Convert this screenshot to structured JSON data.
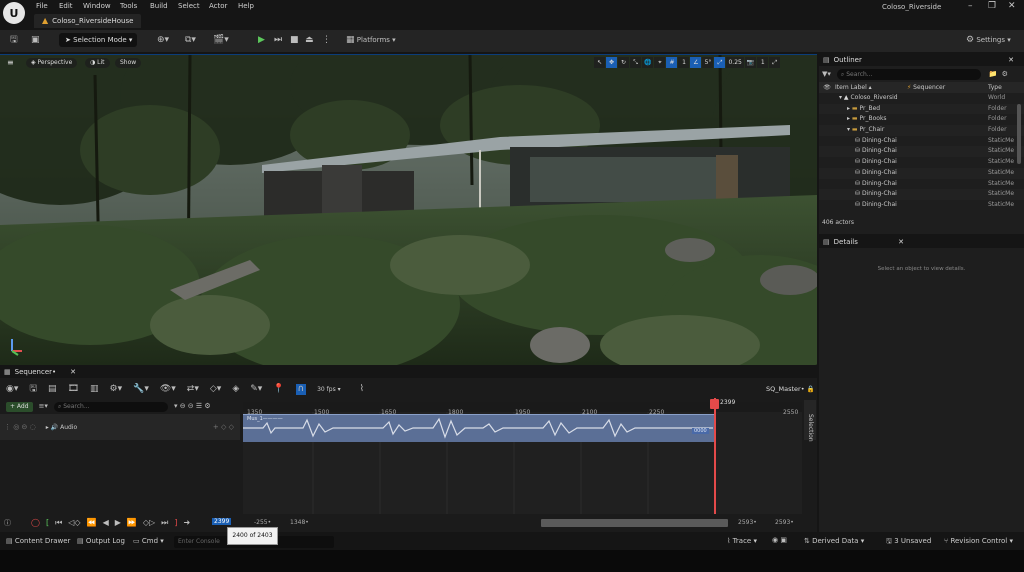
{
  "menu": {
    "items": [
      "File",
      "Edit",
      "Window",
      "Tools",
      "Build",
      "Select",
      "Actor",
      "Help"
    ],
    "project_tab": "Coloso_RiversideHouse",
    "window_title": "Coloso_Riverside"
  },
  "toolbar": {
    "selection_mode": "Selection Mode",
    "platforms": "Platforms",
    "settings": "Settings"
  },
  "viewport": {
    "perspective": "Perspective",
    "lit": "Lit",
    "show": "Show",
    "fov_value": "5°",
    "speed_value": "0.25",
    "cam_value": "1",
    "grid_value": "1"
  },
  "outliner": {
    "title": "Outliner",
    "search_placeholder": "Search...",
    "col_label": "Item Label ▴",
    "col_sequencer": "Sequencer",
    "col_type": "Type",
    "rows": [
      {
        "label": "Coloso_Riversid",
        "type": "World",
        "indent": 0,
        "icon": "world"
      },
      {
        "label": "Pr_Bed",
        "type": "Folder",
        "indent": 1,
        "icon": "folder"
      },
      {
        "label": "Pr_Books",
        "type": "Folder",
        "indent": 1,
        "icon": "folder"
      },
      {
        "label": "Pr_Chair",
        "type": "Folder",
        "indent": 1,
        "icon": "folder-open"
      },
      {
        "label": "Dining-Chai",
        "type": "StaticMe",
        "indent": 2,
        "icon": "mesh"
      },
      {
        "label": "Dining-Chai",
        "type": "StaticMe",
        "indent": 2,
        "icon": "mesh"
      },
      {
        "label": "Dining-Chai",
        "type": "StaticMe",
        "indent": 2,
        "icon": "mesh"
      },
      {
        "label": "Dining-Chai",
        "type": "StaticMe",
        "indent": 2,
        "icon": "mesh"
      },
      {
        "label": "Dining-Chai",
        "type": "StaticMe",
        "indent": 2,
        "icon": "mesh"
      },
      {
        "label": "Dining-Chai",
        "type": "StaticMe",
        "indent": 2,
        "icon": "mesh"
      },
      {
        "label": "Dining-Chai",
        "type": "StaticMe",
        "indent": 2,
        "icon": "mesh"
      }
    ],
    "actor_count": "406 actors"
  },
  "details": {
    "title": "Details",
    "empty_text": "Select an object to view details."
  },
  "sequencer": {
    "tab": "Sequencer•",
    "fps": "30 fps",
    "sequence_name": "SQ_Master•",
    "add": "+ Add",
    "search_placeholder": "Search...",
    "track_name": "Audio",
    "clip_label": "Mus_1————",
    "clip_badge": "0000",
    "ticks": [
      "1350",
      "1500",
      "1650",
      "1800",
      "1950",
      "2100",
      "2250",
      "2399",
      "2550"
    ],
    "playhead_frame": "2399",
    "side_label": "Selection",
    "current_frame": "2399",
    "start_frame": "-255•",
    "range_start": "1348•",
    "range_end": "2593•",
    "end_frame": "2593•",
    "tooltip": "2400 of 2403"
  },
  "statusbar": {
    "content_drawer": "Content Drawer",
    "output_log": "Output Log",
    "cmd": "Cmd",
    "console_placeholder": "Enter Console",
    "trace": "Trace",
    "derived_data": "Derived Data",
    "unsaved": "3 Unsaved",
    "revision_control": "Revision Control"
  }
}
